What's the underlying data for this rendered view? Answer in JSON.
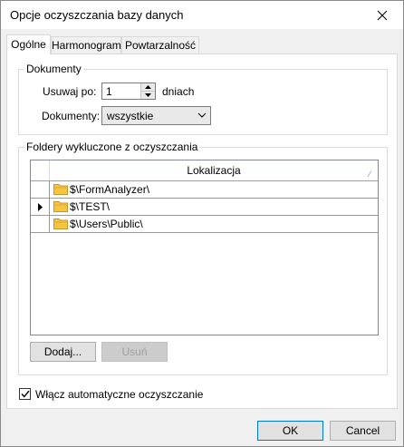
{
  "window": {
    "title": "Opcje oczyszczania bazy danych"
  },
  "tabs": [
    {
      "label": "Ogólne"
    },
    {
      "label": "Harmonogram"
    },
    {
      "label": "Powtarzalność"
    }
  ],
  "documents_group": {
    "legend": "Dokumenty",
    "delete_after_label": "Usuwaj po:",
    "delete_after_value": "1",
    "delete_after_unit": "dniach",
    "documents_label": "Dokumenty:",
    "documents_value": "wszystkie"
  },
  "excluded_group": {
    "legend": "Foldery wykluczone z oczyszczania",
    "column_header": "Lokalizacja",
    "rows": [
      {
        "path": "$\\FormAnalyzer\\"
      },
      {
        "path": "$\\TEST\\"
      },
      {
        "path": "$\\Users\\Public\\"
      }
    ],
    "add_button": "Dodaj...",
    "remove_button": "Usuń"
  },
  "auto_cleanup": {
    "label": "Włącz automatyczne oczyszczanie",
    "checked": true
  },
  "footer": {
    "ok": "OK",
    "cancel": "Cancel"
  },
  "colors": {
    "accent": "#0078d7",
    "folder": "#f5c542"
  }
}
